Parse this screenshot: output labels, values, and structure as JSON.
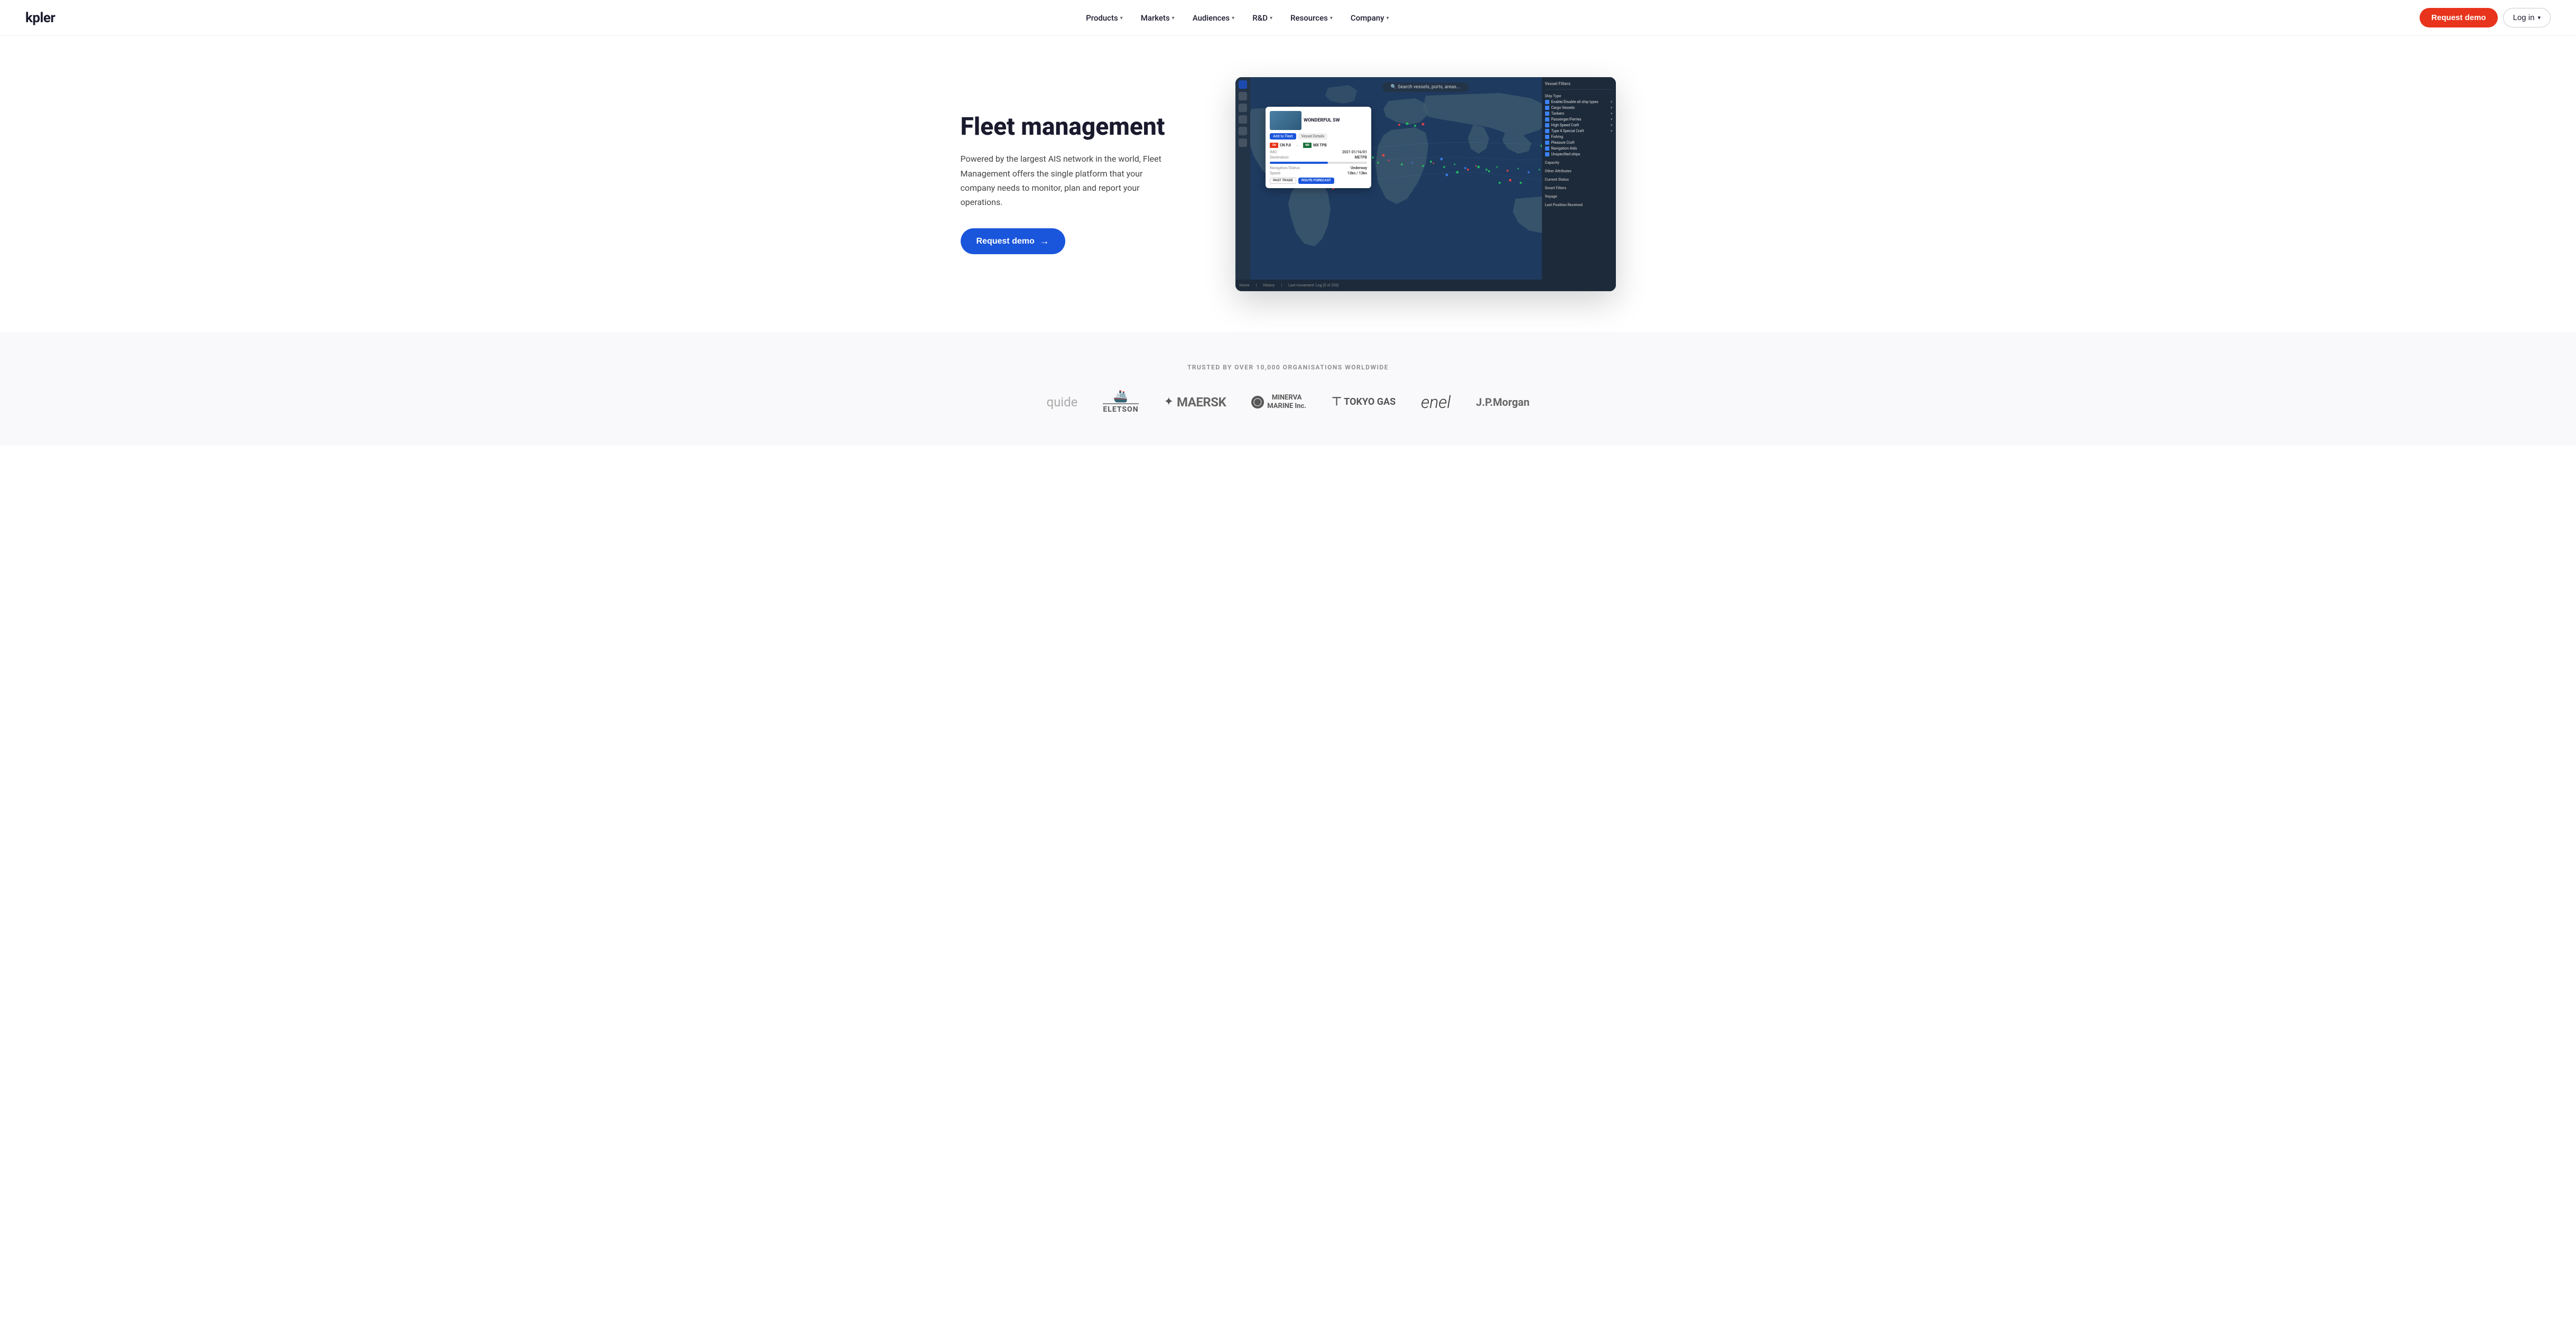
{
  "brand": {
    "logo": "kpler"
  },
  "nav": {
    "links": [
      {
        "label": "Products",
        "has_dropdown": true
      },
      {
        "label": "Markets",
        "has_dropdown": true
      },
      {
        "label": "Audiences",
        "has_dropdown": true
      },
      {
        "label": "R&D",
        "has_dropdown": true
      },
      {
        "label": "Resources",
        "has_dropdown": true
      },
      {
        "label": "Company",
        "has_dropdown": true
      }
    ],
    "request_demo": "Request demo",
    "login": "Log in"
  },
  "hero": {
    "title": "Fleet management",
    "description": "Powered by the largest AIS network in the world, Fleet Management offers the single platform that your company needs to monitor, plan and report your operations.",
    "cta": "Request demo"
  },
  "map": {
    "search_placeholder": "Search vessels, ports...",
    "vessel_name": "WONDERFUL SW",
    "vessel_flag_from": "CN PJI",
    "vessel_flag_to": "MX TPB",
    "tab_add_to_fleet": "Add to Fleet",
    "tab_vessel_details": "Vessel Details",
    "past_trade": "PAST TRADE",
    "route_forecast": "ROUTE FORECAST",
    "panel_title": "Vessel Filters",
    "ship_types": [
      "Enable/Disable all ship types",
      "Cargo Vessels",
      "Tankers",
      "Passenger/Ferries",
      "High Speed Craft",
      "Type 4 Special Craft",
      "Fishing",
      "Pleasure Craft",
      "Navigation Aids",
      "Unspecified ships"
    ],
    "capacity_label": "Capacity",
    "other_attributes": "Other Attributes",
    "current_status": "Current Status",
    "smart_filters": "Smart Filters",
    "voyage": "Voyage",
    "last_position_received": "Last Position Received"
  },
  "trust": {
    "label": "TRUSTED BY OVER 10,000 ORGANISATIONS WORLDWIDE",
    "logos": [
      {
        "name": "quide",
        "text": "quide",
        "style": "quide"
      },
      {
        "name": "eletson",
        "text": "ELETSON",
        "style": "eletson"
      },
      {
        "name": "maersk",
        "text": "MAERSK",
        "style": "maersk"
      },
      {
        "name": "minerva",
        "text": "MINERVA\nMARINE Inc.",
        "style": "minerva"
      },
      {
        "name": "tokyo-gas",
        "text": "TOKYO GAS",
        "style": "tokyo"
      },
      {
        "name": "enel",
        "text": "enel",
        "style": "enel"
      },
      {
        "name": "jpmorgan",
        "text": "J.P.Morgan",
        "style": "jpmorgan"
      }
    ]
  }
}
